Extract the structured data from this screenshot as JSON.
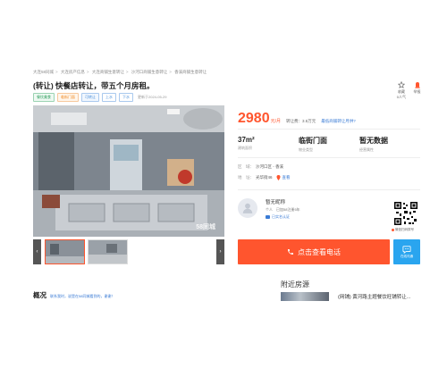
{
  "breadcrumb": [
    "大连58同城",
    "大连房产信息",
    "大连商铺生意转让",
    "沙河口商铺生意转让",
    "香溪商铺生意转让"
  ],
  "title": "(转让) 快餐店转让，带五个月房租。",
  "tags": [
    {
      "label": "餐饮美食",
      "style": "green"
    },
    {
      "label": "临街门面",
      "style": "orange"
    },
    {
      "label": "可转让",
      "style": "blue"
    },
    {
      "label": "上水",
      "style": "plain"
    },
    {
      "label": "下水",
      "style": "plain"
    }
  ],
  "publish_date": "更新于2024-05-29",
  "actions": {
    "favorite_label": "收藏",
    "favorite_count": "0人气",
    "report_label": "举报"
  },
  "price": {
    "amount": "2980",
    "unit": "元/月",
    "fee": "转让费：3.5万元",
    "calc_link": "最低商铺转让月供?"
  },
  "stats": [
    {
      "value": "37m²",
      "label": "建筑面积"
    },
    {
      "value": "临街门面",
      "label": "物业类型"
    },
    {
      "value": "暂无数据",
      "label": "经营属性"
    }
  ],
  "info": {
    "area_key": "区　域：",
    "area_value": "沙河口区 - 香溪",
    "addr_key": "地　址：",
    "addr_value": "光华街46",
    "map_link": "查看"
  },
  "agent": {
    "name": "暂无昵称",
    "sub": "个人　已加58注册5年",
    "verify": "已实名认证"
  },
  "qr_caption": "微信扫码拨号",
  "call_button": "点击查看电话",
  "chat_button": "在线沟通",
  "watermark": "58同城",
  "overview": {
    "heading": "概况",
    "sub": "联系我时，说是在58同城看到的，谢谢！"
  },
  "nearby": {
    "heading": "附近房源",
    "item": "(网铺) 黄河路主题餐饮旺铺转让..."
  },
  "colors": {
    "accent": "#ff552e",
    "link": "#3a7bd5",
    "chat": "#2aa5ef"
  }
}
